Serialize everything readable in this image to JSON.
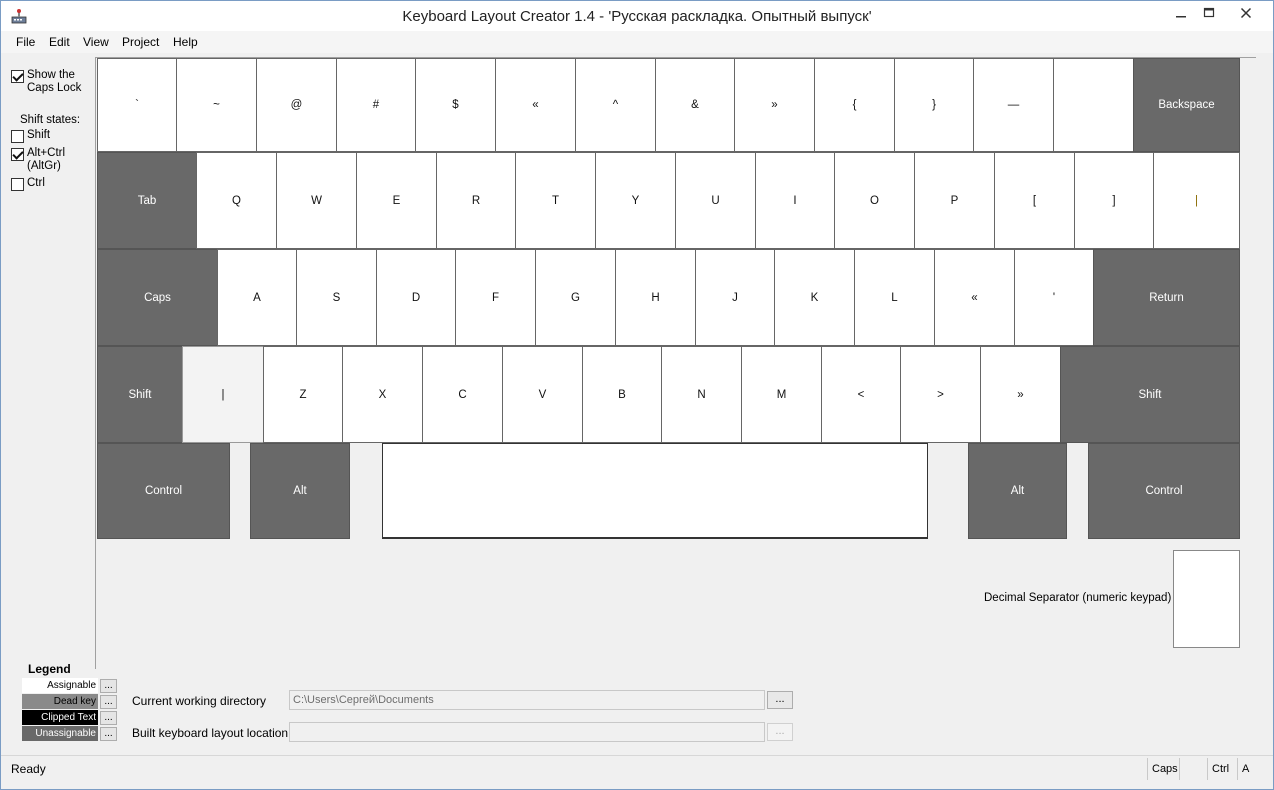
{
  "window": {
    "title": "Keyboard Layout Creator 1.4 - 'Русская раскладка. Опытный выпуск'",
    "minimize_glyph": "—",
    "maximize_glyph": "☐",
    "close_glyph": "✕"
  },
  "menu": [
    "File",
    "Edit",
    "View",
    "Project",
    "Help"
  ],
  "left_panel": {
    "caps_lock_label_1": "Show the",
    "caps_lock_label_2": "Caps Lock",
    "caps_lock_checked": true,
    "shift_states_label": "Shift states:",
    "shift_label": "Shift",
    "shift_checked": false,
    "altctrl_label_1": "Alt+Ctrl",
    "altctrl_label_2": "(AltGr)",
    "altctrl_checked": true,
    "ctrl_label": "Ctrl",
    "ctrl_checked": false
  },
  "keyboard": {
    "row1": [
      "`",
      "~",
      "@",
      "#",
      "$",
      "«",
      "^",
      "&",
      "»",
      "{",
      "}",
      "—",
      "",
      "Backspace"
    ],
    "row2": [
      "Tab",
      "Q",
      "W",
      "E",
      "R",
      "T",
      "Y",
      "U",
      "I",
      "O",
      "P",
      "[",
      "]",
      "|"
    ],
    "row3": [
      "Caps",
      "A",
      "S",
      "D",
      "F",
      "G",
      "H",
      "J",
      "K",
      "L",
      "«",
      "'",
      "Return"
    ],
    "row4": [
      "Shift",
      "|",
      "Z",
      "X",
      "C",
      "V",
      "B",
      "N",
      "M",
      "<",
      ">",
      "»",
      "Shift"
    ],
    "row5": [
      "Control",
      "Alt",
      "",
      "Alt",
      "Control"
    ],
    "decimal_label": "Decimal Separator (numeric keypad)"
  },
  "legend": {
    "title": "Legend",
    "assignable": "Assignable",
    "dead_key": "Dead key",
    "clipped_text": "Clipped Text",
    "unassignable": "Unassignable",
    "button": "..."
  },
  "paths": {
    "cwd_label": "Current working directory",
    "cwd_value": "C:\\Users\\Сергей\\Documents",
    "built_label": "Built keyboard layout location",
    "built_value": "",
    "button": "..."
  },
  "status": {
    "text": "Ready",
    "caps": "Caps",
    "ctrl": "Ctrl",
    "alt": "A"
  },
  "colors": {
    "key_dark": "#696969",
    "key_white": "#ffffff",
    "background": "#f0f0f0"
  }
}
